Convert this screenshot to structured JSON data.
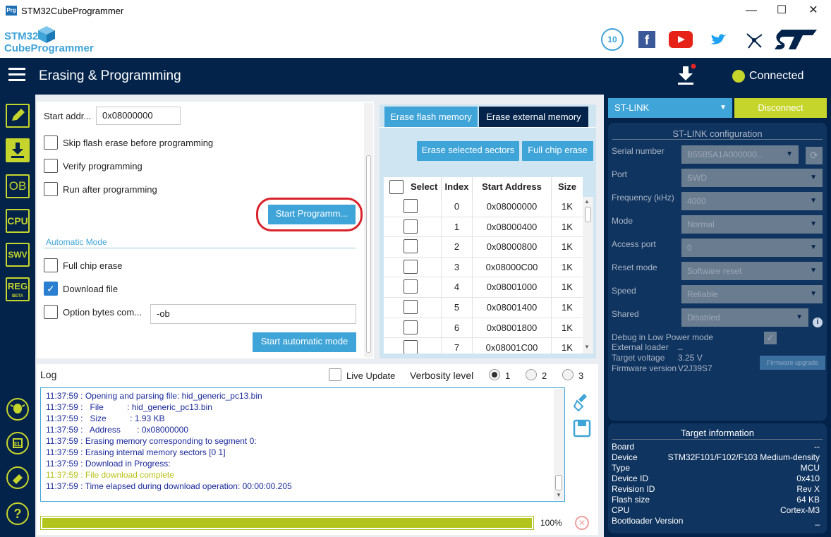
{
  "window": {
    "app_icon_text": "Prg",
    "title": "STM32CubeProgrammer",
    "minimize": "—",
    "maximize": "☐",
    "close": "✕"
  },
  "brand": {
    "logo_line1": "STM32",
    "logo_line2": "CubeProgrammer"
  },
  "header": {
    "title": "Erasing & Programming",
    "status": "Connected"
  },
  "leftbar": {
    "items": [
      "OB",
      "CPU",
      "SWV",
      "REG"
    ],
    "reg_sub": "BETA",
    "help": "?"
  },
  "programming": {
    "start_addr_label": "Start addr...",
    "start_addr_value": "0x08000000",
    "skip_erase_label": "Skip flash erase before programming",
    "verify_label": "Verify programming",
    "run_after_label": "Run after programming",
    "start_button": "Start Programm...",
    "auto_mode_title": "Automatic Mode",
    "full_chip_erase_label": "Full chip erase",
    "download_file_label": "Download file",
    "option_bytes_label": "Option bytes com...",
    "option_bytes_value": "-ob",
    "start_auto_button": "Start automatic mode"
  },
  "erase": {
    "tab_flash": "Erase flash memory",
    "tab_external": "Erase external memory",
    "erase_selected": "Erase selected sectors",
    "full_chip_erase": "Full chip erase",
    "columns": [
      "Select",
      "Index",
      "Start Address",
      "Size"
    ],
    "rows": [
      {
        "index": "0",
        "address": "0x08000000",
        "size": "1K"
      },
      {
        "index": "1",
        "address": "0x08000400",
        "size": "1K"
      },
      {
        "index": "2",
        "address": "0x08000800",
        "size": "1K"
      },
      {
        "index": "3",
        "address": "0x08000C00",
        "size": "1K"
      },
      {
        "index": "4",
        "address": "0x08001000",
        "size": "1K"
      },
      {
        "index": "5",
        "address": "0x08001400",
        "size": "1K"
      },
      {
        "index": "6",
        "address": "0x08001800",
        "size": "1K"
      },
      {
        "index": "7",
        "address": "0x08001C00",
        "size": "1K"
      }
    ]
  },
  "log": {
    "title": "Log",
    "live_update": "Live Update",
    "verbosity_label": "Verbosity level",
    "levels": [
      "1",
      "2",
      "3"
    ],
    "selected_level": "1",
    "lines": [
      {
        "text": "11:37:59 : Opening and parsing file: hid_generic_pc13.bin",
        "color": "#1b2a9a"
      },
      {
        "text": "11:37:59 :   File          : hid_generic_pc13.bin",
        "color": "#1b2a9a"
      },
      {
        "text": "11:37:59 :   Size          : 1.93 KB",
        "color": "#1b2a9a"
      },
      {
        "text": "11:37:59 :   Address       : 0x08000000",
        "color": "#1b2a9a"
      },
      {
        "text": "11:37:59 : Erasing memory corresponding to segment 0:",
        "color": "#1b2a9a"
      },
      {
        "text": "11:37:59 : Erasing internal memory sectors [0 1]",
        "color": "#1b2a9a"
      },
      {
        "text": "11:37:59 : Download in Progress:",
        "color": "#1b2a9a"
      },
      {
        "text": "11:37:59 : File download complete",
        "color": "#b9c21a"
      },
      {
        "text": "11:37:59 : Time elapsed during download operation: 00:00:00.205",
        "color": "#1b2a9a"
      }
    ],
    "progress_percent": 100,
    "progress_label": "100%"
  },
  "stlink": {
    "interface": "ST-LINK",
    "disconnect": "Disconnect",
    "config_title": "ST-LINK configuration",
    "fields": [
      {
        "label": "Serial number",
        "value": "B55B5A1A000000..."
      },
      {
        "label": "Port",
        "value": "SWD"
      },
      {
        "label": "Frequency (kHz)",
        "value": "4000"
      },
      {
        "label": "Mode",
        "value": "Normal"
      },
      {
        "label": "Access port",
        "value": "0"
      },
      {
        "label": "Reset mode",
        "value": "Software reset"
      },
      {
        "label": "Speed",
        "value": "Reliable"
      },
      {
        "label": "Shared",
        "value": "Disabled"
      }
    ],
    "debug_low_power": "Debug in Low Power mode",
    "external_loader": "External loader",
    "external_loader_value": "_",
    "target_voltage": "Target voltage",
    "target_voltage_value": "3.25 V",
    "firmware_version": "Firmware version",
    "firmware_version_value": "V2J39S7",
    "firmware_upgrade": "Firmware upgrade"
  },
  "target": {
    "title": "Target information",
    "rows": [
      {
        "label": "Board",
        "value": "--"
      },
      {
        "label": "Device",
        "value": "STM32F101/F102/F103 Medium-density"
      },
      {
        "label": "Type",
        "value": "MCU"
      },
      {
        "label": "Device ID",
        "value": "0x410"
      },
      {
        "label": "Revision ID",
        "value": "Rev X"
      },
      {
        "label": "Flash size",
        "value": "64 KB"
      },
      {
        "label": "CPU",
        "value": "Cortex-M3"
      },
      {
        "label": "Bootloader Version",
        "value": "_"
      }
    ]
  },
  "colors": {
    "navy": "#03234b",
    "accent": "#3fa4d8",
    "lime": "#c6d52b",
    "highlight_ring": "#d9222a"
  }
}
